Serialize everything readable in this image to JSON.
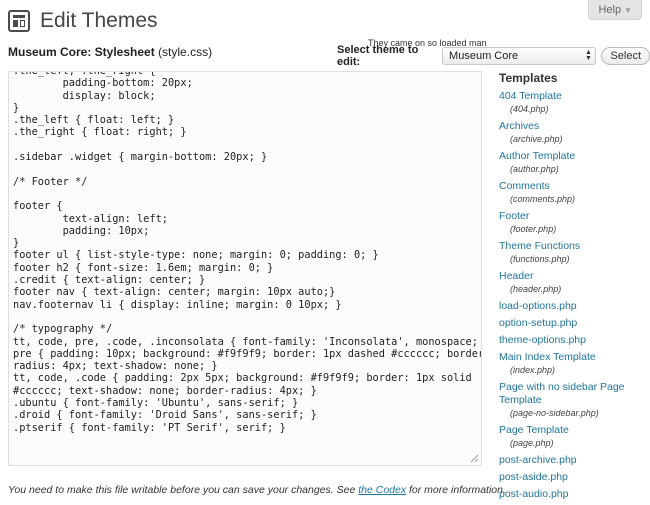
{
  "help": {
    "label": "Help",
    "icon": "caret-down-icon"
  },
  "header": {
    "title": "Edit Themes",
    "icon": "appearance-icon"
  },
  "file": {
    "theme_name": "Museum Core: Stylesheet",
    "file_name": "(style.css)"
  },
  "quote": "They came on so loaded man",
  "theme_select": {
    "label": "Select theme to edit:",
    "value": "Museum Core",
    "button": "Select"
  },
  "editor": {
    "content": ".the_left, .the_right {\n        padding-bottom: 20px;\n        display: block;\n}\n.the_left { float: left; }\n.the_right { float: right; }\n\n.sidebar .widget { margin-bottom: 20px; }\n\n/* Footer */\n\nfooter {\n        text-align: left;\n        padding: 10px;\n}\nfooter ul { list-style-type: none; margin: 0; padding: 0; }\nfooter h2 { font-size: 1.6em; margin: 0; }\n.credit { text-align: center; }\nfooter nav { text-align: center; margin: 10px auto;}\nnav.footernav li { display: inline; margin: 0 10px; }\n\n/* typography */\ntt, code, pre, .code, .inconsolata { font-family: 'Inconsolata', monospace; }\npre { padding: 10px; background: #f9f9f9; border: 1px dashed #cccccc; border-\nradius: 4px; text-shadow: none; }\ntt, code, .code { padding: 2px 5px; background: #f9f9f9; border: 1px solid\n#cccccc; text-shadow: none; border-radius: 4px; }\n.ubuntu { font-family: 'Ubuntu', sans-serif; }\n.droid { font-family: 'Droid Sans', sans-serif; }\n.ptserif { font-family: 'PT Serif', serif; }"
  },
  "notice": {
    "before": "You need to make this file writable before you can save your changes. See ",
    "link": "the Codex",
    "after": " for more information."
  },
  "sidebar": {
    "heading": "Templates",
    "templates": [
      {
        "name": "404 Template",
        "file": "(404.php)"
      },
      {
        "name": "Archives",
        "file": "(archive.php)"
      },
      {
        "name": "Author Template",
        "file": "(author.php)"
      },
      {
        "name": "Comments",
        "file": "(comments.php)"
      },
      {
        "name": "Footer",
        "file": "(footer.php)"
      },
      {
        "name": "Theme Functions",
        "file": "(functions.php)"
      },
      {
        "name": "Header",
        "file": "(header.php)"
      },
      {
        "name": "load-options.php",
        "file": ""
      },
      {
        "name": "option-setup.php",
        "file": ""
      },
      {
        "name": "theme-options.php",
        "file": ""
      },
      {
        "name": "Main Index Template",
        "file": "(index.php)"
      },
      {
        "name": "Page with no sidebar Page Template",
        "file": "(page-no-sidebar.php)"
      },
      {
        "name": "Page Template",
        "file": "(page.php)"
      },
      {
        "name": "post-archive.php",
        "file": ""
      },
      {
        "name": "post-aside.php",
        "file": ""
      },
      {
        "name": "post-audio.php",
        "file": ""
      }
    ]
  },
  "colors": {
    "link": "#21759b",
    "text": "#333333",
    "editor_bg": "#fcfcfc"
  }
}
